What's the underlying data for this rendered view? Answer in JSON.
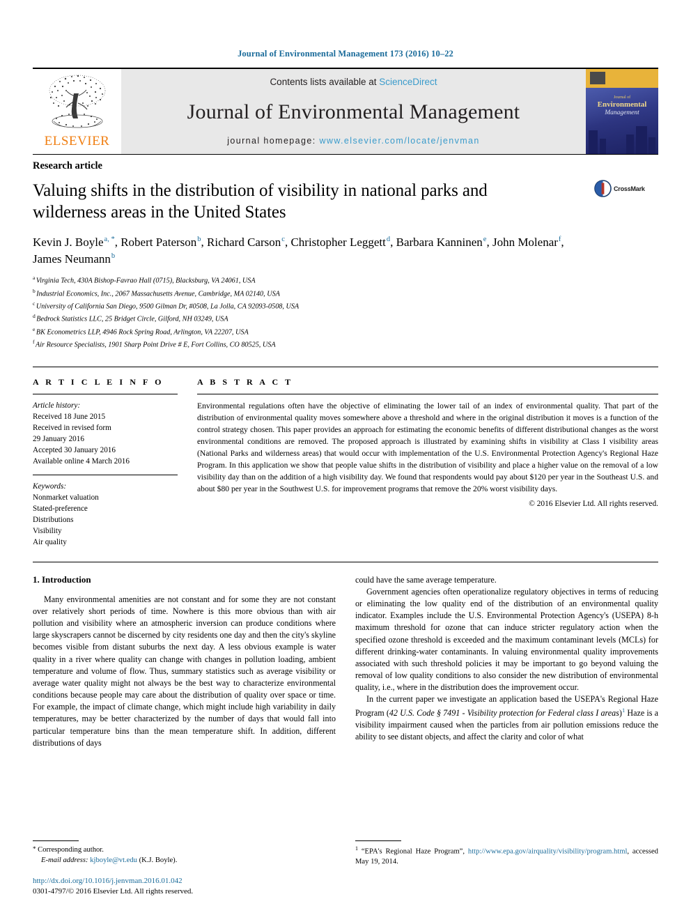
{
  "running_head": "Journal of Environmental Management 173 (2016) 10–22",
  "masthead": {
    "contents_prefix": "Contents lists available at ",
    "sciencedirect": "ScienceDirect",
    "journal_name": "Journal of Environmental Management",
    "homepage_prefix": "journal homepage: ",
    "homepage_url": "www.elsevier.com/locate/jenvman",
    "publisher": "ELSEVIER",
    "publisher_logo_icon": "elsevier-tree-logo",
    "cover": {
      "line1": "Journal of",
      "line2": "Environmental",
      "line3": "Management"
    }
  },
  "article": {
    "type": "Research article",
    "title": "Valuing shifts in the distribution of visibility in national parks and wilderness areas in the United States",
    "crossmark_label": "CrossMark",
    "authors": [
      {
        "name": "Kevin J. Boyle",
        "marks": "a, *",
        "sep": ", "
      },
      {
        "name": "Robert Paterson",
        "marks": "b",
        "sep": ", "
      },
      {
        "name": "Richard Carson",
        "marks": "c",
        "sep": ", "
      },
      {
        "name": "Christopher Leggett",
        "marks": "d",
        "sep": ", "
      },
      {
        "name": "Barbara Kanninen",
        "marks": "e",
        "sep": ", "
      },
      {
        "name": "John Molenar",
        "marks": "f",
        "sep": ", "
      },
      {
        "name": "James Neumann",
        "marks": "b",
        "sep": ""
      }
    ],
    "affiliations": [
      {
        "mark": "a",
        "text": "Virginia Tech, 430A Bishop-Favrao Hall (0715), Blacksburg, VA 24061, USA"
      },
      {
        "mark": "b",
        "text": "Industrial Economics, Inc., 2067 Massachusetts Avenue, Cambridge, MA 02140, USA"
      },
      {
        "mark": "c",
        "text": "University of California San Diego, 9500 Gilman Dr, #0508, La Jolla, CA 92093-0508, USA"
      },
      {
        "mark": "d",
        "text": "Bedrock Statistics LLC, 25 Bridget Circle, Gilford, NH 03249, USA"
      },
      {
        "mark": "e",
        "text": "BK Econometrics LLP, 4946 Rock Spring Road, Arlington, VA 22207, USA"
      },
      {
        "mark": "f",
        "text": "Air Resource Specialists, 1901 Sharp Point Drive # E, Fort Collins, CO 80525, USA"
      }
    ]
  },
  "info": {
    "heading": "A R T I C L E  I N F O",
    "history_label": "Article history:",
    "history": [
      "Received 18 June 2015",
      "Received in revised form",
      "29 January 2016",
      "Accepted 30 January 2016",
      "Available online 4 March 2016"
    ],
    "keywords_label": "Keywords:",
    "keywords": [
      "Nonmarket valuation",
      "Stated-preference",
      "Distributions",
      "Visibility",
      "Air quality"
    ]
  },
  "abstract": {
    "heading": "A B S T R A C T",
    "text": "Environmental regulations often have the objective of eliminating the lower tail of an index of environmental quality. That part of the distribution of environmental quality moves somewhere above a threshold and where in the original distribution it moves is a function of the control strategy chosen. This paper provides an approach for estimating the economic benefits of different distributional changes as the worst environmental conditions are removed. The proposed approach is illustrated by examining shifts in visibility at Class I visibility areas (National Parks and wilderness areas) that would occur with implementation of the U.S. Environmental Protection Agency's Regional Haze Program. In this application we show that people value shifts in the distribution of visibility and place a higher value on the removal of a low visibility day than on the addition of a high visibility day. We found that respondents would pay about $120 per year in the Southeast U.S. and about $80 per year in the Southwest U.S. for improvement programs that remove the 20% worst visibility days.",
    "copyright": "© 2016 Elsevier Ltd. All rights reserved."
  },
  "body": {
    "section_title": "1. Introduction",
    "left_paragraphs": [
      "Many environmental amenities are not constant and for some they are not constant over relatively short periods of time. Nowhere is this more obvious than with air pollution and visibility where an atmospheric inversion can produce conditions where large skyscrapers cannot be discerned by city residents one day and then the city's skyline becomes visible from distant suburbs the next day. A less obvious example is water quality in a river where quality can change with changes in pollution loading, ambient temperature and volume of flow. Thus, summary statistics such as average visibility or average water quality might not always be the best way to characterize environmental conditions because people may care about the distribution of quality over space or time. For example, the impact of climate change, which might include high variability in daily temperatures, may be better characterized by the number of days that would fall into particular temperature bins than the mean temperature shift. In addition, different distributions of days"
    ],
    "right_continuation": "could have the same average temperature.",
    "right_paragraphs": [
      "Government agencies often operationalize regulatory objectives in terms of reducing or eliminating the low quality end of the distribution of an environmental quality indicator. Examples include the U.S. Environmental Protection Agency's (USEPA) 8-h maximum threshold for ozone that can induce stricter regulatory action when the specified ozone threshold is exceeded and the maximum contaminant levels (MCLs) for different drinking-water contaminants. In valuing environmental quality improvements associated with such threshold policies it may be important to go beyond valuing the removal of low quality conditions to also consider the new distribution of environmental quality, i.e., where in the distribution does the improvement occur."
    ],
    "right_last_paragraph": {
      "pre": "In the current paper we investigate an application based the USEPA's Regional Haze Program (",
      "italic": "42 U.S. Code § 7491 - Visibility protection for Federal class I areas",
      "mid": ")",
      "ref": "1",
      "post": " Haze is a visibility impairment caused when the particles from air pollution emissions reduce the ability to see distant objects, and affect the clarity and color of what"
    }
  },
  "footnotes": {
    "corresponding_marker": "*",
    "corresponding_text": "Corresponding author.",
    "email_label": "E-mail address:",
    "email": "kjboyle@vt.edu",
    "email_suffix": "(K.J. Boyle).",
    "doi": "http://dx.doi.org/10.1016/j.jenvman.2016.01.042",
    "issn_line": "0301-4797/© 2016 Elsevier Ltd. All rights reserved.",
    "right_marker": "1",
    "right_pre": "“EPA's Regional Haze Program”, ",
    "right_url": "http://www.epa.gov/airquality/visibility/program.html",
    "right_post": ", accessed May 19, 2014."
  },
  "colors": {
    "link_blue": "#1a6b9a",
    "sciencedirect_blue": "#3a9bcb",
    "elsevier_orange": "#f07f13"
  }
}
